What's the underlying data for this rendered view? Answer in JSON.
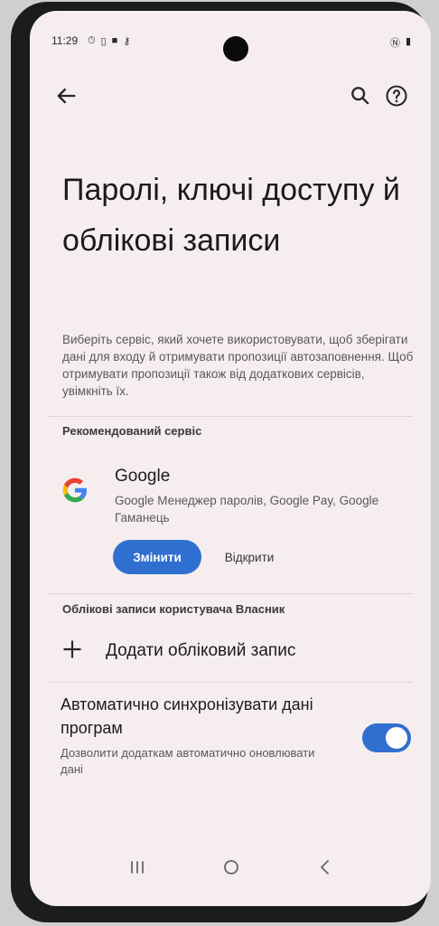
{
  "status_bar": {
    "time": "11:29",
    "left_icons": [
      "alarm-icon",
      "sim-icon",
      "lock-icon",
      "key-icon"
    ],
    "right_icons": [
      "nfc-icon",
      "battery-icon"
    ]
  },
  "toolbar": {
    "back_icon": "arrow-back-icon",
    "search_icon": "search-icon",
    "help_icon": "help-icon"
  },
  "page": {
    "title": "Паролі, ключі доступу й облікові записи",
    "description": "Виберіть сервіс, який хочете використовувати, щоб зберігати дані для входу й отримувати пропозиції автозаповнення. Щоб отримувати пропозиції також від додаткових сервісів, увімкніть їх."
  },
  "recommended": {
    "header": "Рекомендований сервіс",
    "service": {
      "name": "Google",
      "description": "Google Менеджер паролів, Google Pay, Google Гаманець"
    },
    "change_label": "Змінити",
    "open_label": "Відкрити"
  },
  "accounts": {
    "header": "Облікові записи користувача Власник",
    "add_label": "Додати обліковий запис"
  },
  "sync": {
    "title": "Автоматично синхронізувати дані програм",
    "description": "Дозволити додаткам автоматично оновлювати дані",
    "enabled": true
  },
  "colors": {
    "accent": "#2f6fcf",
    "background": "#f6eeee",
    "text": "#1e1b1b",
    "secondary_text": "#5c5757"
  }
}
